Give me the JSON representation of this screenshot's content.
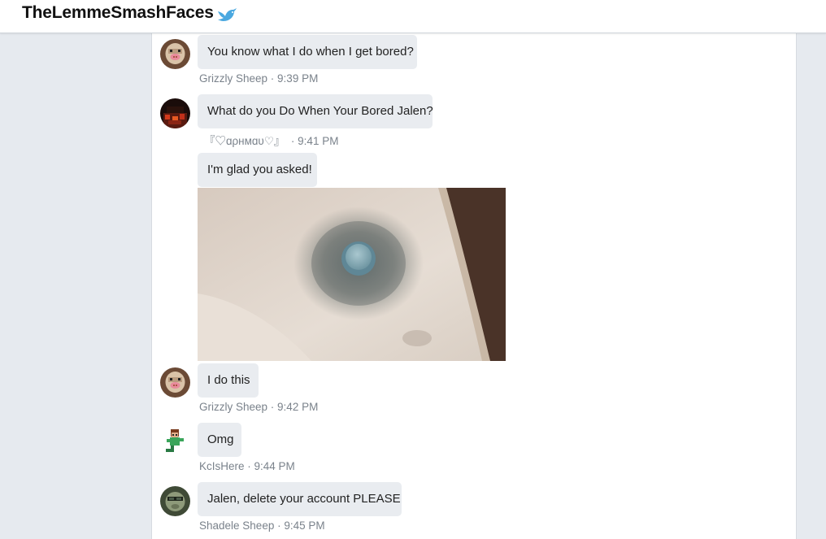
{
  "header": {
    "title": "TheLemmeSmashFaces",
    "icon": "bird-icon"
  },
  "colors": {
    "bubble": "#e9ecf0",
    "meta_text": "#7a828b",
    "page_bg": "#e6eaef",
    "accent_bird": "#4aa8e0"
  },
  "messages": [
    {
      "text": "You know what I do when I get bored?",
      "author": "Grizzly Sheep",
      "time": "9:39 PM"
    },
    {
      "text": "What do you Do When Your Bored Jalen?",
      "author": "『♡ɑρнмɑυ♡』",
      "time": "9:41 PM"
    },
    {
      "text": "I'm glad you asked!"
    },
    {
      "image": "fidget-spinner-photo"
    },
    {
      "text": "I do this",
      "author": "Grizzly Sheep",
      "time": "9:42 PM"
    },
    {
      "text": "Omg",
      "author": "KcIsHere",
      "time": "9:44 PM"
    },
    {
      "text": "Jalen, delete your account PLEASE",
      "author": "Shadele Sheep",
      "time": "9:45 PM"
    }
  ],
  "separator": " · "
}
